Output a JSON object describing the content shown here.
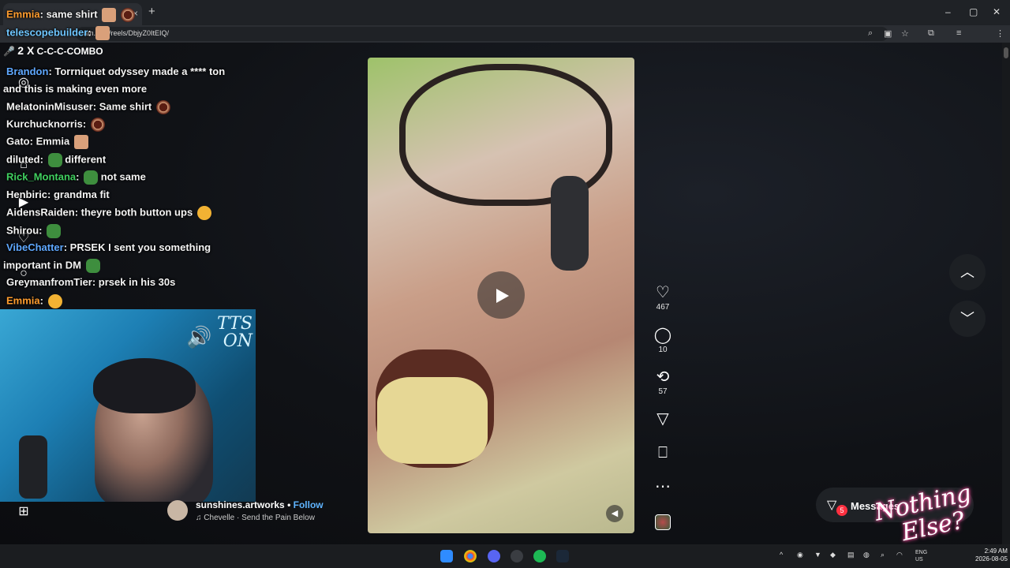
{
  "browser": {
    "url": "instagram.com/reels/DbjyZ0ItEIQ/",
    "url_visible": "am.com/reels/DbjyZ0ItEIQ/",
    "new_tab_label": "+",
    "tab_close": "×",
    "minimize": "–",
    "maximize": "▢",
    "close": "✕"
  },
  "chat": {
    "combo_count": "2 X",
    "combo_label": "C-C-C-COMBO",
    "messages": [
      {
        "user": "Emmia",
        "text": ": same shirt"
      },
      {
        "user": "telescopebuilder",
        "text": ":"
      },
      {
        "user": "Brandon",
        "text": ": Torrniquet odyssey made a **** ton"
      },
      {
        "user": "",
        "text": "and this is making even more"
      },
      {
        "user": "MelatoninMisuser",
        "text": ": Same shirt"
      },
      {
        "user": "Kurchucknorris",
        "text": ":"
      },
      {
        "user": "Gato",
        "text": ": Emmia"
      },
      {
        "user": "diluted",
        "text": ":"
      },
      {
        "user": "",
        "text": "different"
      },
      {
        "user": "Rick_Montana",
        "text": ":"
      },
      {
        "user": "",
        "text": "not same"
      },
      {
        "user": "Henbiric",
        "text": ": grandma fit"
      },
      {
        "user": "AidensRaiden",
        "text": ": theyre both button ups"
      },
      {
        "user": "Shirou",
        "text": ":"
      },
      {
        "user": "VibeChatter",
        "text": ": PRSEK I sent you something"
      },
      {
        "user": "",
        "text": "important in DM"
      },
      {
        "user": "GreymanfromTier",
        "text": ": prsek in his 30s"
      },
      {
        "user": "Emmia",
        "text": ":"
      }
    ]
  },
  "webcam": {
    "tts_line1": "TTS",
    "tts_line2": "ON"
  },
  "reel": {
    "creator": "sunshines.artworks",
    "separator": "•",
    "follow_label": "Follow",
    "audio": "Chevelle · Send the Pain Below",
    "likes": "467",
    "comments": "10",
    "reposts": "57"
  },
  "messages": {
    "label": "Messages",
    "badge": "5"
  },
  "overlay": {
    "line1": "Nothing",
    "line2": "Else?"
  },
  "taskbar": {
    "lang1": "ENG",
    "lang2": "US",
    "time": "2:49 AM",
    "date": "2026-08-05"
  },
  "colors": {
    "accent_blue": "#5fb4ff",
    "badge_red": "#ff3040",
    "background": "#0e1013"
  }
}
